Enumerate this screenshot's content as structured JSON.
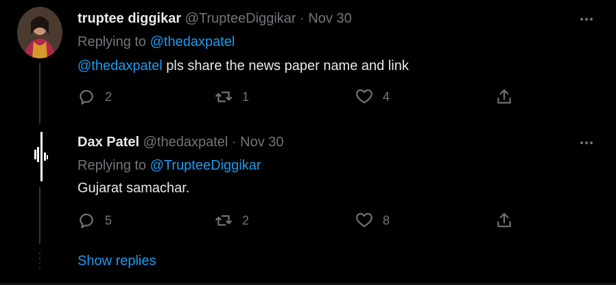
{
  "tweets": [
    {
      "name": "truptee diggikar",
      "handle": "@TrupteeDiggikar",
      "separator": "·",
      "date": "Nov 30",
      "replying_prefix": "Replying to",
      "replying_to": "@thedaxpatel",
      "text_mention": "@thedaxpatel",
      "text": " pls share the news paper name and link",
      "reply_count": "2",
      "retweet_count": "1",
      "like_count": "4"
    },
    {
      "name": "Dax Patel",
      "handle": "@thedaxpatel",
      "separator": "·",
      "date": "Nov 30",
      "replying_prefix": "Replying to",
      "replying_to": "@TrupteeDiggikar",
      "text": "Gujarat samachar.",
      "reply_count": "5",
      "retweet_count": "2",
      "like_count": "8"
    }
  ],
  "show_replies": "Show replies",
  "icons": [
    "reply-icon",
    "retweet-icon",
    "like-icon",
    "share-icon",
    "more-icon"
  ],
  "colors": {
    "background": "#000000",
    "text": "#e7e9ea",
    "muted": "#71767b",
    "link": "#1d9bf0"
  }
}
